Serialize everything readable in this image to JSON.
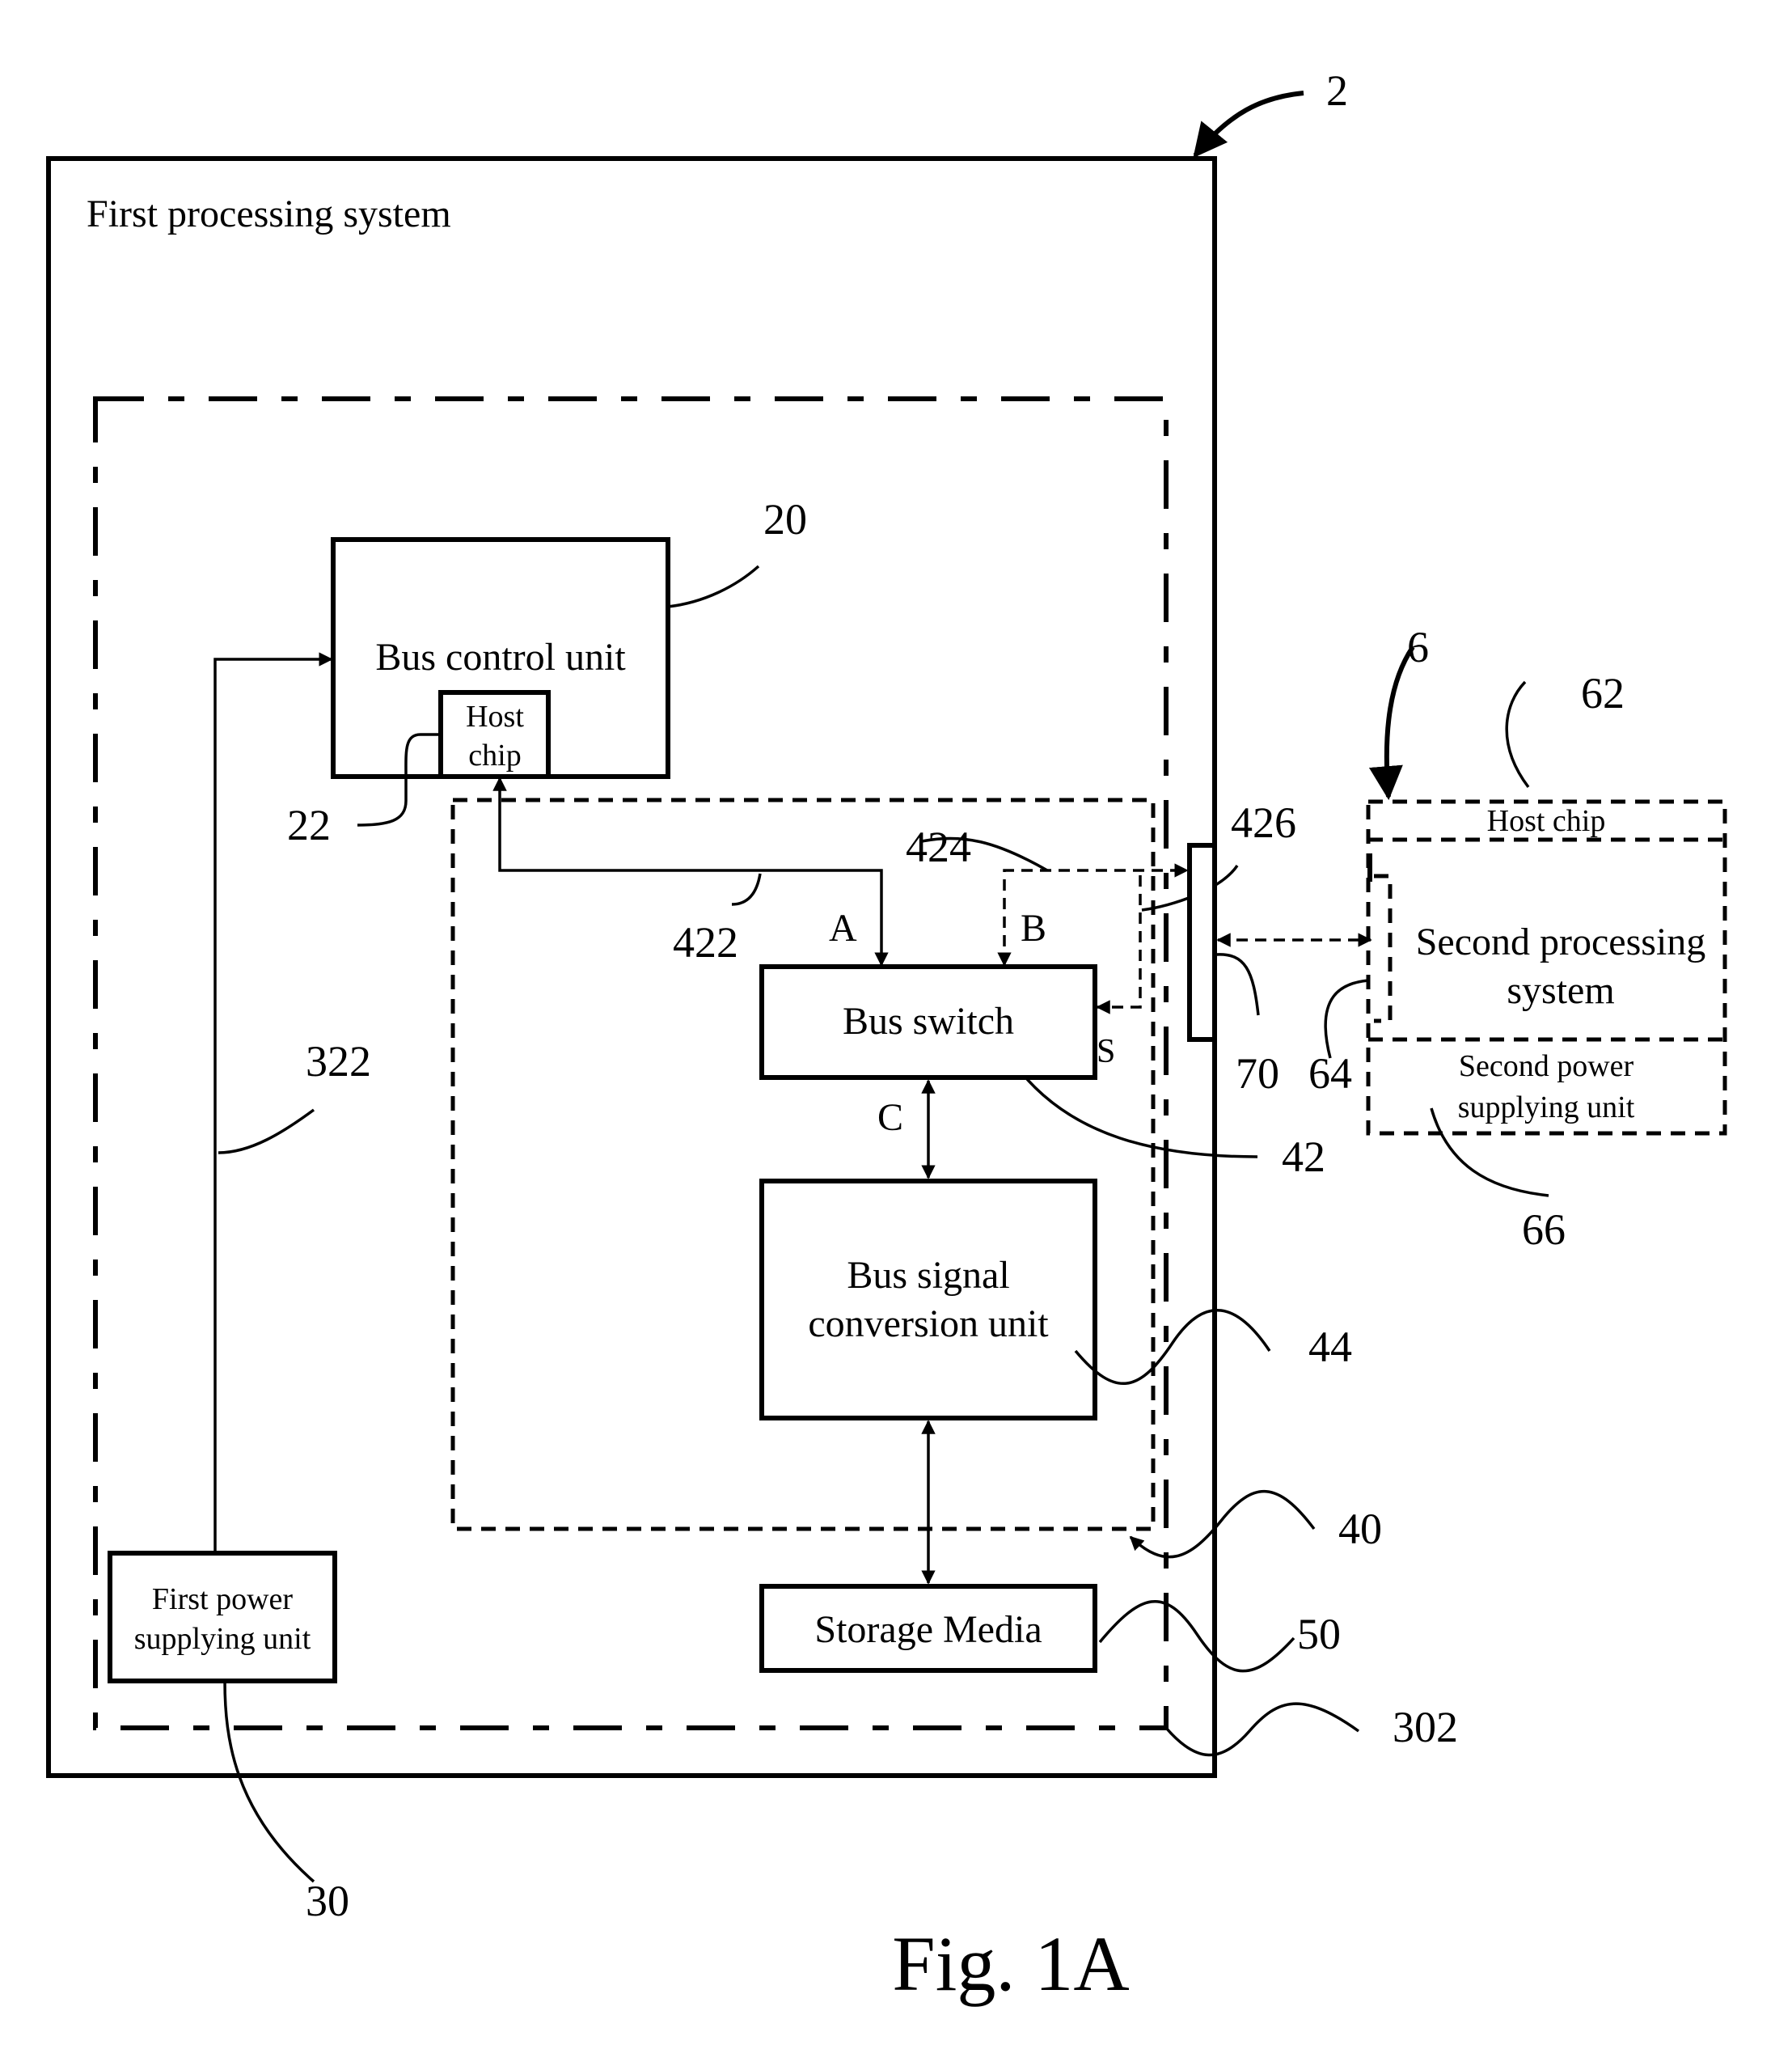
{
  "figure": {
    "caption": "Fig. 1A",
    "ref_system": "2"
  },
  "first_system": {
    "title": "First processing system",
    "ref_dashed_region": "302",
    "bus_control_unit": {
      "label": "Bus control unit",
      "ref": "20"
    },
    "host_chip": {
      "line1": "Host",
      "line2": "chip",
      "ref": "22"
    },
    "power_line_ref": "322",
    "first_power": {
      "line1": "First power",
      "line2": "supplying unit",
      "ref": "30"
    },
    "module_ref": "40",
    "bus_switch": {
      "label": "Bus switch",
      "ref": "42"
    },
    "bus_signal_conversion": {
      "line1": "Bus signal",
      "line2": "conversion unit",
      "ref": "44"
    },
    "storage_media": {
      "label": "Storage Media",
      "ref": "50"
    },
    "signal_paths": {
      "A": "A",
      "B": "B",
      "C": "C",
      "S": "S",
      "ref_422": "422",
      "ref_424": "424",
      "ref_426": "426"
    },
    "connector_ref": "70"
  },
  "second_system": {
    "ref": "6",
    "host_chip": {
      "label": "Host chip",
      "ref": "62"
    },
    "title_line1": "Second processing",
    "title_line2": "system",
    "port_ref": "64",
    "second_power": {
      "line1": "Second power",
      "line2": "supplying unit",
      "ref": "66"
    }
  }
}
